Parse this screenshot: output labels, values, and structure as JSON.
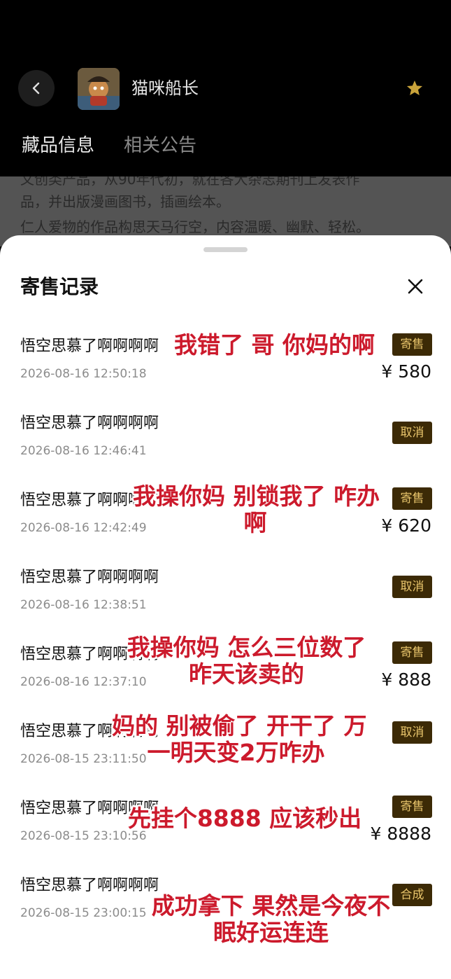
{
  "header": {
    "title": "猫咪船长",
    "icons": {
      "back": "chevron-left-icon",
      "favorite": "star-icon"
    },
    "favorite_color": "#c9a33a"
  },
  "tabs": [
    {
      "label": "藏品信息",
      "active": true
    },
    {
      "label": "相关公告",
      "active": false
    }
  ],
  "description": {
    "lines": [
      "文创类产品，从90年代初，就在各大杂志期刊上发表作",
      "品，并出版漫画图书，插画绘本。",
      "仁人爱物的作品构思天马行空，内容温暖、幽默、轻松。"
    ]
  },
  "sheet": {
    "title": "寄售记录",
    "close_icon": "close-icon",
    "records": [
      {
        "name": "悟空思慕了啊啊啊啊",
        "time": "2026-08-16 12:50:18",
        "status": "寄售",
        "price": "¥ 580"
      },
      {
        "name": "悟空思慕了啊啊啊啊",
        "time": "2026-08-16 12:46:41",
        "status": "取消",
        "price": ""
      },
      {
        "name": "悟空思慕了啊啊啊啊",
        "time": "2026-08-16 12:42:49",
        "status": "寄售",
        "price": "¥ 620"
      },
      {
        "name": "悟空思慕了啊啊啊啊",
        "time": "2026-08-16 12:38:51",
        "status": "取消",
        "price": ""
      },
      {
        "name": "悟空思慕了啊啊啊啊",
        "time": "2026-08-16 12:37:10",
        "status": "寄售",
        "price": "¥ 888"
      },
      {
        "name": "悟空思慕了啊啊啊啊",
        "time": "2026-08-15 23:11:50",
        "status": "取消",
        "price": ""
      },
      {
        "name": "悟空思慕了啊啊啊啊",
        "time": "2026-08-15 23:10:56",
        "status": "寄售",
        "price": "¥ 8888"
      },
      {
        "name": "悟空思慕了啊啊啊啊",
        "time": "2026-08-15 23:00:15",
        "status": "合成",
        "price": ""
      }
    ]
  },
  "captions": [
    {
      "lines": [
        "我错了 哥 你妈的啊"
      ]
    },
    {
      "lines": [
        "我操你妈 别锁我了 咋办",
        "啊"
      ]
    },
    {
      "lines": [
        "我操你妈 怎么三位数了",
        "昨天该卖的"
      ]
    },
    {
      "lines": [
        "妈的 别被偷了 开干了 万",
        "一明天变2万咋办"
      ]
    },
    {
      "lines": [
        "先挂个8888 应该秒出"
      ]
    },
    {
      "lines": [
        "成功拿下 果然是今夜不",
        "眠好运连连"
      ]
    }
  ],
  "colors": {
    "badge_bg": "#3c2a06",
    "badge_text": "#e9c56c",
    "caption_red": "#cc1a2c"
  }
}
